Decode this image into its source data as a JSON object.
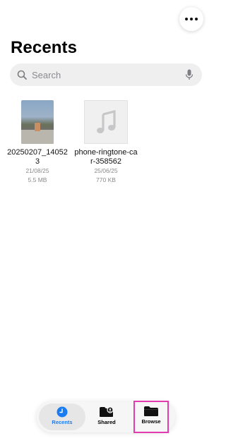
{
  "header": {
    "more_icon": "ellipsis-icon",
    "title": "Recents"
  },
  "search": {
    "placeholder": "Search",
    "search_icon": "magnifier-icon",
    "mic_icon": "microphone-icon"
  },
  "files": [
    {
      "name": "20250207_140523",
      "date": "21/08/25",
      "size": "5.5 MB",
      "kind": "image"
    },
    {
      "name": "phone-ringtone-car-358562",
      "date": "25/06/25",
      "size": "770 KB",
      "kind": "audio",
      "icon": "music-note-icon"
    }
  ],
  "tabbar": {
    "tabs": [
      {
        "label": "Recents",
        "icon": "clock-icon",
        "selected": true
      },
      {
        "label": "Shared",
        "icon": "shared-folder-icon",
        "selected": false
      },
      {
        "label": "Browse",
        "icon": "folder-icon",
        "selected": false,
        "highlighted": true
      }
    ]
  },
  "colors": {
    "accent": "#1a7cf2",
    "highlight": "#e23cb0"
  }
}
